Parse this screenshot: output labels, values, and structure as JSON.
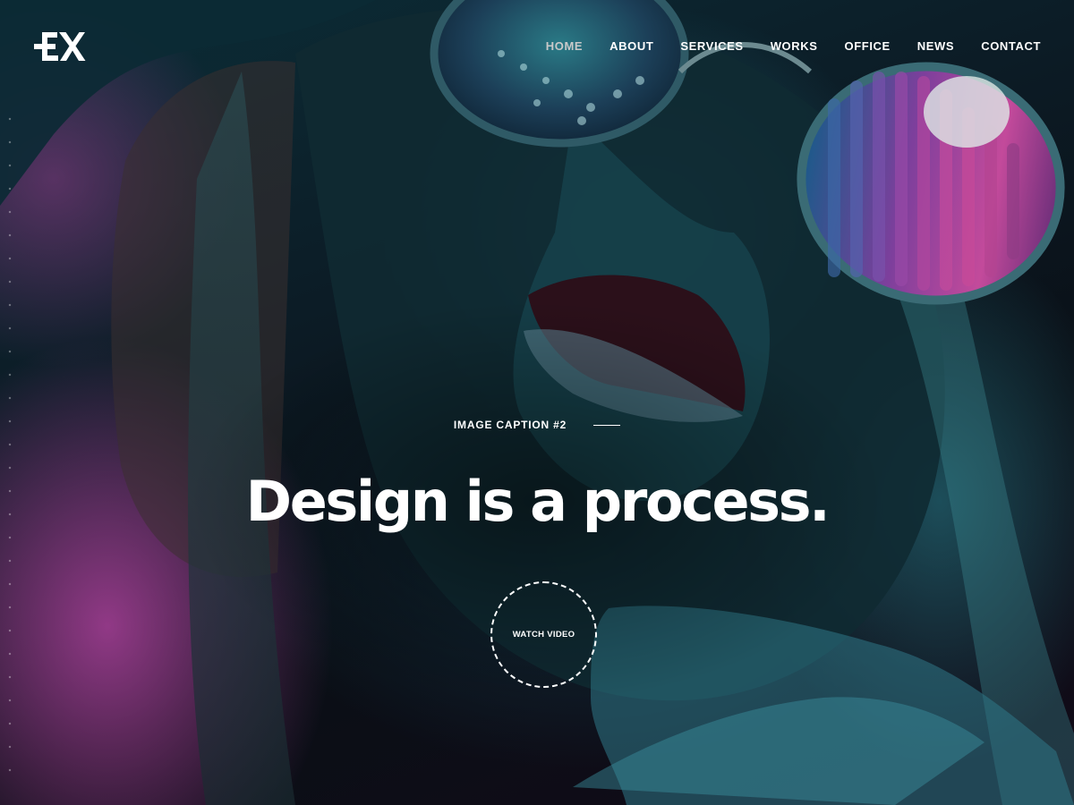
{
  "brand": {
    "logo_text": "EX",
    "logo_icon": "ex-logo-icon"
  },
  "nav": {
    "items": [
      {
        "label": "HOME",
        "active": true
      },
      {
        "label": "ABOUT",
        "active": false
      },
      {
        "label": "SERVICES",
        "active": false
      },
      {
        "label": "WORKS",
        "active": false
      },
      {
        "label": "OFFICE",
        "active": false
      },
      {
        "label": "NEWS",
        "active": false
      },
      {
        "label": "CONTACT",
        "active": false
      }
    ]
  },
  "hero": {
    "caption": "IMAGE CAPTION #2",
    "headline": "Design is a process.",
    "video_button_label": "WATCH VIDEO",
    "video_icon": "play-circle-icon"
  },
  "colors": {
    "text": "#ffffff",
    "nav_active": "#c9c9c9",
    "accent_teal": "#1f6f7e",
    "accent_magenta": "#b8479f",
    "background": "#0a0f16"
  }
}
